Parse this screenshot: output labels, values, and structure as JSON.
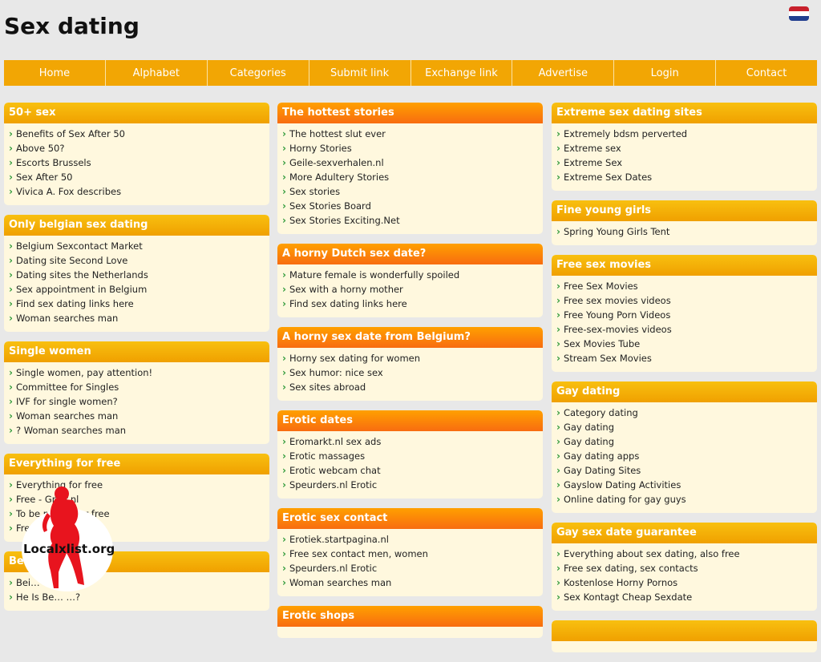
{
  "header": {
    "title": "Sex dating"
  },
  "menu": [
    "Home",
    "Alphabet",
    "Categories",
    "Submit link",
    "Exchange link",
    "Advertise",
    "Login",
    "Contact"
  ],
  "columns": [
    [
      {
        "title": "50+ sex",
        "links": [
          "Benefits of Sex After 50",
          "Above 50?",
          "Escorts Brussels",
          "Sex After 50",
          "Vivica A. Fox describes"
        ]
      },
      {
        "title": "Only belgian sex dating",
        "links": [
          "Belgium Sexcontact Market",
          "Dating site Second Love",
          "Dating sites the Netherlands",
          "Sex appointment in Belgium",
          "Find sex dating links here",
          "Woman searches man"
        ]
      },
      {
        "title": "Single women",
        "links": [
          "Single women, pay attention!",
          "Committee for Singles",
          "IVF for single women?",
          "Woman searches man",
          "? Woman searches man"
        ]
      },
      {
        "title": "Everything for free",
        "links": [
          "Everything for free",
          "Free - Gr…f.nl",
          "To be p… up for free",
          "Free…"
        ]
      },
      {
        "title": "Be…",
        "links": [
          "Bei…",
          "He Is Be… …?"
        ]
      }
    ],
    [
      {
        "title": "The hottest stories",
        "links": [
          "The hottest slut ever",
          "Horny Stories",
          "Geile-sexverhalen.nl",
          "More Adultery Stories",
          "Sex stories",
          "Sex Stories Board",
          "Sex Stories Exciting.Net"
        ]
      },
      {
        "title": "A horny Dutch sex date?",
        "links": [
          "Mature female is wonderfully spoiled",
          "Sex with a horny mother",
          "Find sex dating links here"
        ]
      },
      {
        "title": "A horny sex date from Belgium?",
        "links": [
          "Horny sex dating for women",
          "Sex humor: nice sex",
          "Sex sites abroad"
        ]
      },
      {
        "title": "Erotic dates",
        "links": [
          "Eromarkt.nl sex ads",
          "Erotic massages",
          "Erotic webcam chat",
          "Speurders.nl Erotic"
        ]
      },
      {
        "title": "Erotic sex contact",
        "links": [
          "Erotiek.startpagina.nl",
          "Free sex contact men, women",
          "Speurders.nl Erotic",
          "Woman searches man"
        ]
      },
      {
        "title": "Erotic shops",
        "links": []
      }
    ],
    [
      {
        "title": "Extreme sex dating sites",
        "links": [
          "Extremely bdsm perverted",
          "Extreme sex",
          "Extreme Sex",
          "Extreme Sex Dates"
        ]
      },
      {
        "title": "Fine young girls",
        "links": [
          "Spring Young Girls Tent"
        ]
      },
      {
        "title": "Free sex movies",
        "links": [
          "Free Sex Movies",
          "Free sex movies videos",
          "Free Young Porn Videos",
          "Free-sex-movies videos",
          "Sex Movies Tube",
          "Stream Sex Movies"
        ]
      },
      {
        "title": "Gay dating",
        "links": [
          "Category dating",
          "Gay dating",
          "Gay dating",
          "Gay dating apps",
          "Gay Dating Sites",
          "Gayslow Dating Activities",
          "Online dating for gay guys"
        ]
      },
      {
        "title": "Gay sex date guarantee",
        "links": [
          "Everything about sex dating, also free",
          "Free sex dating, sex contacts",
          "Kostenlose Horny Pornos",
          "Sex Kontagt Cheap Sexdate"
        ]
      },
      {
        "title": "",
        "links": []
      }
    ]
  ],
  "watermark": {
    "text": "Localxlist.org"
  },
  "colors": {
    "menu": "#f2a604",
    "box_bg": "#fff8de",
    "bullet": "#2f9a3a"
  }
}
